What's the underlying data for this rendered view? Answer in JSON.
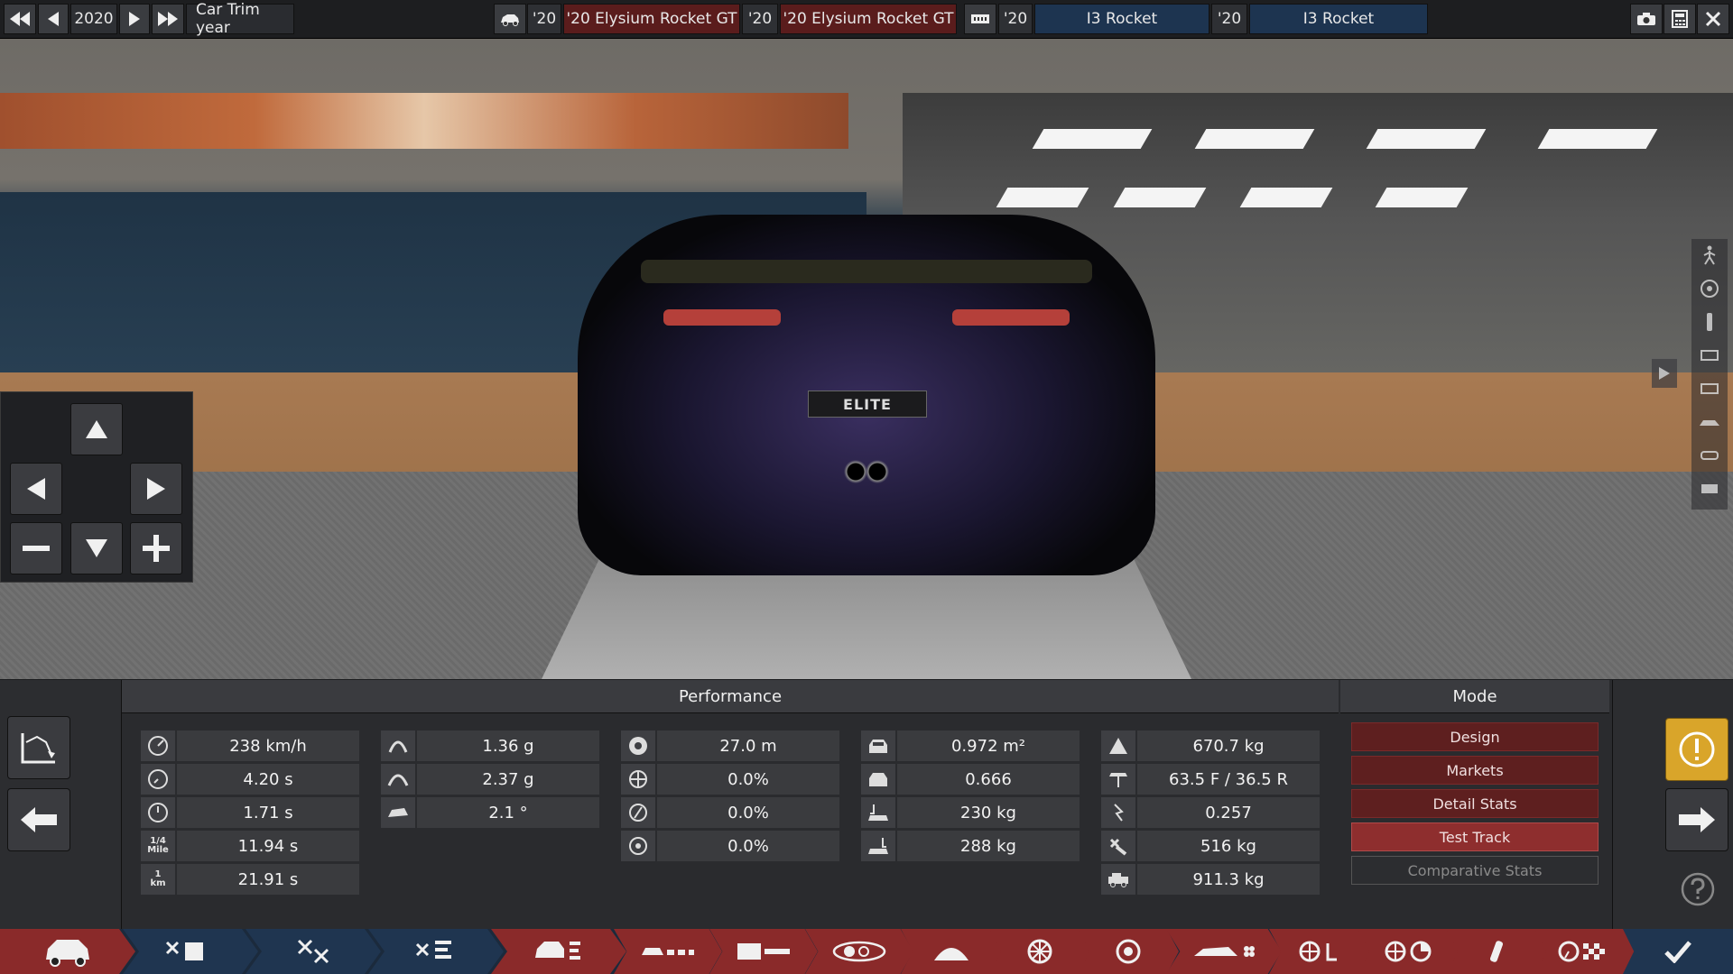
{
  "topbar": {
    "year_value": "2020",
    "year_label": "Car Trim year",
    "slots": [
      {
        "year": "'20",
        "name": "'20 Elysium Rocket GT"
      },
      {
        "year": "'20",
        "name": "'20 Elysium Rocket GT"
      },
      {
        "year": "'20",
        "name": "I3 Rocket"
      },
      {
        "year": "'20",
        "name": "I3 Rocket"
      }
    ],
    "icons": [
      "rewind-icon",
      "prev-icon",
      "next-icon",
      "fast-forward-icon",
      "car-icon",
      "engine-icon",
      "camera-icon",
      "calculator-icon",
      "close-icon"
    ]
  },
  "scene": {
    "plate_text": "ELITE"
  },
  "camera_pad": {
    "icons": [
      "up-arrow-icon",
      "left-arrow-icon",
      "right-arrow-icon",
      "zoom-out-icon",
      "down-arrow-icon",
      "zoom-in-icon"
    ]
  },
  "performance": {
    "title": "Performance",
    "col1": [
      {
        "icon": "top-speed-icon",
        "value": "238 km/h"
      },
      {
        "icon": "accel-0-100-icon",
        "value": "4.20 s"
      },
      {
        "icon": "accel-0-60-icon",
        "value": "1.71 s"
      },
      {
        "icon_text_top": "1/4",
        "icon_text_bottom": "Mile",
        "value": "11.94 s"
      },
      {
        "icon_text_top": "1",
        "icon_text_bottom": "km",
        "value": "21.91 s"
      }
    ],
    "col2": [
      {
        "icon": "cornering-icon",
        "value": "1.36 g"
      },
      {
        "icon": "braking-g-icon",
        "value": "2.37 g"
      },
      {
        "icon": "body-roll-icon",
        "value": "2.1 °"
      }
    ],
    "col3": [
      {
        "icon": "braking-distance-icon",
        "value": "27.0 m"
      },
      {
        "icon": "brake-fade-icon",
        "value": "0.0%"
      },
      {
        "icon": "brake-fade-2-icon",
        "value": "0.0%"
      },
      {
        "icon": "brake-fade-3-icon",
        "value": "0.0%"
      }
    ],
    "col4": [
      {
        "icon": "frontal-area-icon",
        "value": "0.972 m²"
      },
      {
        "icon": "drag-coefficient-icon",
        "value": "0.666"
      },
      {
        "icon": "front-downforce-icon",
        "value": "230 kg"
      },
      {
        "icon": "rear-downforce-icon",
        "value": "288 kg"
      }
    ],
    "col5": [
      {
        "icon": "weight-icon",
        "value": "670.7 kg"
      },
      {
        "icon": "weight-distribution-icon",
        "value": "63.5 F / 36.5 R"
      },
      {
        "icon": "power-to-weight-icon",
        "value": "0.257"
      },
      {
        "icon": "engine-weight-icon",
        "value": "516 kg"
      },
      {
        "icon": "total-weight-icon",
        "value": "911.3 kg"
      }
    ]
  },
  "mode": {
    "title": "Mode",
    "buttons": [
      "Design",
      "Markets",
      "Detail Stats",
      "Test Track",
      "Comparative Stats"
    ],
    "active": "Test Track"
  },
  "colors": {
    "accent_red": "#8e2e2e",
    "warning_yellow": "#d9a52a",
    "tab_blue": "#1f3550",
    "tab_red": "#8a2a2a"
  },
  "tabs": [
    "car-tab",
    "engine-design-tab",
    "engine-tab",
    "engine-trim-tab",
    "car-trim-tab",
    "chassis-tab",
    "suspension-tab",
    "lights-tab",
    "brakes-tab",
    "wheels-tab",
    "rims-tab",
    "aero-tab",
    "interior-tab",
    "drivetrain-tab",
    "fuel-tab",
    "test-track-tab",
    "finish-tab"
  ]
}
